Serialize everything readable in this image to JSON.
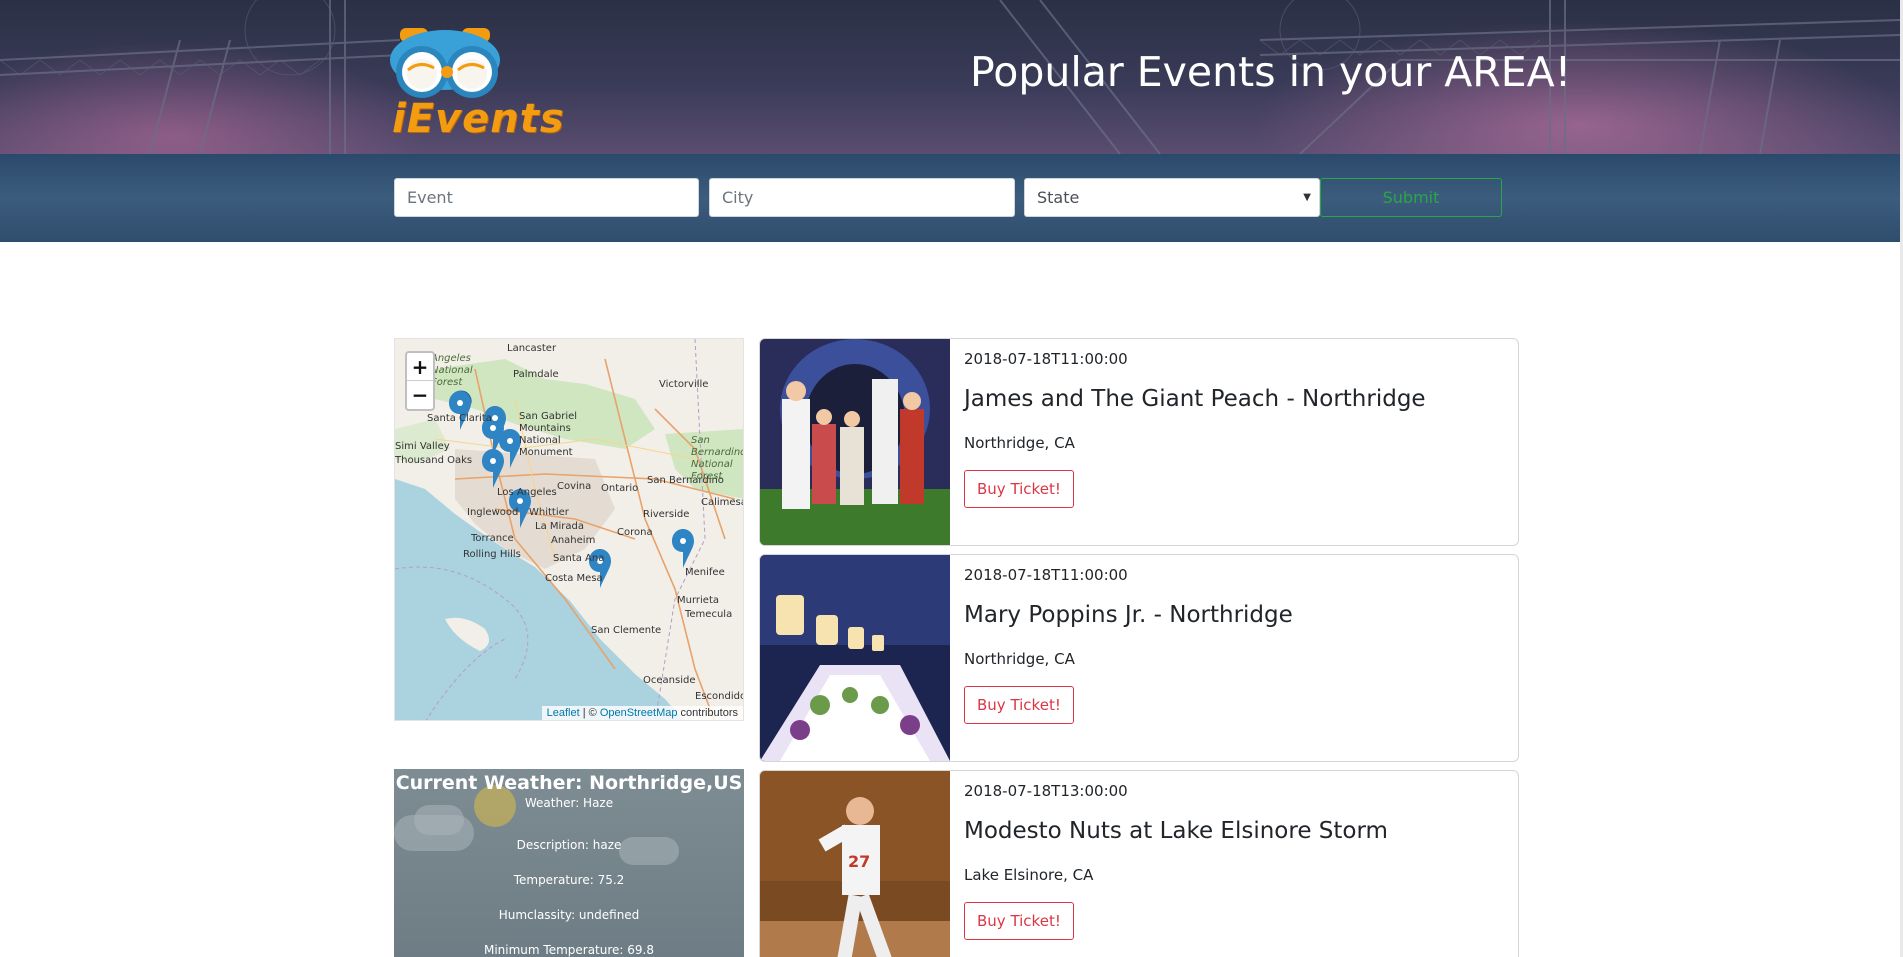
{
  "header": {
    "logo_text": "iEvents",
    "title": "Popular Events in your AREA!"
  },
  "search": {
    "event_placeholder": "Event",
    "city_placeholder": "City",
    "state_selected": "State",
    "submit_label": "Submit"
  },
  "map": {
    "zoom_in": "+",
    "zoom_out": "−",
    "places": [
      "Lancaster",
      "Palmdale",
      "Victorville",
      "Santa Clarita",
      "San Gabriel Mountains National Monument",
      "Simi Valley",
      "Thousand Oaks",
      "Los Angeles",
      "Covina",
      "Ontario",
      "San Bernardino",
      "San Bernardino National Forest",
      "Calimesa",
      "Inglewood",
      "Whittier",
      "Riverside",
      "La Mirada",
      "Torrance",
      "Anaheim",
      "Corona",
      "Rolling Hills",
      "Santa Ana",
      "Menifee",
      "Costa Mesa",
      "Murrieta",
      "Temecula",
      "San Clemente",
      "Oceanside",
      "Escondido",
      "Angeles National Forest"
    ],
    "attribution_leaflet": "Leaflet",
    "attribution_sep": " | © ",
    "attribution_osm": "OpenStreetMap",
    "attribution_rest": " contributors"
  },
  "weather": {
    "title": "Current Weather: Northridge,US",
    "weather": "Weather: Haze",
    "description": "Description: haze",
    "temperature": "Temperature: 75.2",
    "humidity": "Humclassity: undefined",
    "min_temp": "Minimum Temperature: 69.8"
  },
  "events": [
    {
      "date": "2018-07-18T11:00:00",
      "title": "James and The Giant Peach - Northridge",
      "location": "Northridge, CA",
      "button": "Buy Ticket!"
    },
    {
      "date": "2018-07-18T11:00:00",
      "title": "Mary Poppins Jr. - Northridge",
      "location": "Northridge, CA",
      "button": "Buy Ticket!"
    },
    {
      "date": "2018-07-18T13:00:00",
      "title": "Modesto Nuts at Lake Elsinore Storm",
      "location": "Lake Elsinore, CA",
      "button": "Buy Ticket!"
    }
  ]
}
